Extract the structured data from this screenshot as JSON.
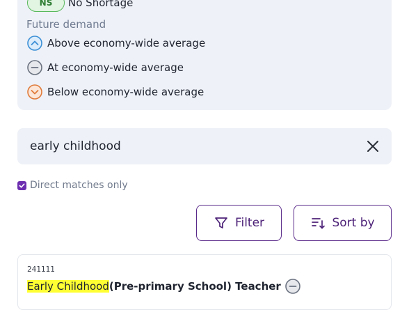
{
  "legend": {
    "shortage_badge": "NS",
    "shortage_label": "No Shortage",
    "future_demand_heading": "Future demand",
    "items": [
      {
        "icon": "chevron-up-circle-icon",
        "label": "Above economy-wide average",
        "color": "#3b8fd6"
      },
      {
        "icon": "minus-circle-icon",
        "label": "At economy-wide average",
        "color": "#6b7280"
      },
      {
        "icon": "chevron-down-circle-icon",
        "label": "Below economy-wide average",
        "color": "#e07a3a"
      }
    ]
  },
  "search": {
    "value": "early childhood",
    "clear_icon": "close-icon"
  },
  "filters": {
    "direct_matches_label": "Direct matches only",
    "direct_matches_checked": true,
    "filter_label": "Filter",
    "sort_label": "Sort by"
  },
  "results": [
    {
      "code": "241111",
      "title_highlight": "Early Childhood",
      "title_rest": " (Pre-primary School) Teacher",
      "demand_icon": "minus-circle-icon"
    }
  ],
  "colors": {
    "accent": "#5a2a8a",
    "panel_bg": "#eef1f7",
    "highlight": "#ffff33"
  }
}
